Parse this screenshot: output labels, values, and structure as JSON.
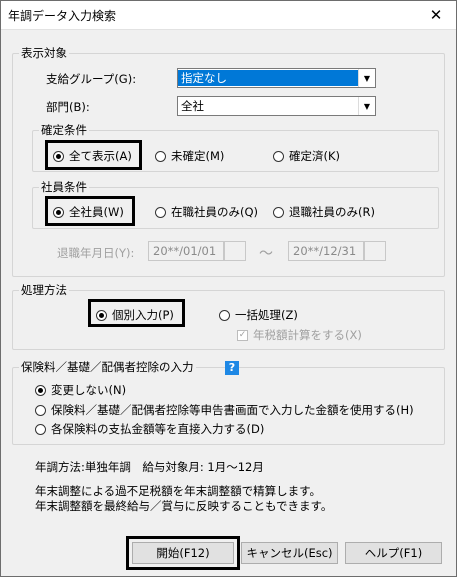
{
  "window": {
    "title": "年調データ入力検索",
    "close_glyph": "✕"
  },
  "display_target": {
    "label": "表示対象",
    "group_label": "支給グループ(G):",
    "group_value": "指定なし",
    "dept_label": "部門(B):",
    "dept_value": "全社",
    "confirm": {
      "label": "確定条件",
      "options": [
        "全て表示(A)",
        "未確定(M)",
        "確定済(K)"
      ],
      "selected": 0
    },
    "employee": {
      "label": "社員条件",
      "options": [
        "全社員(W)",
        "在職社員のみ(Q)",
        "退職社員のみ(R)"
      ],
      "selected": 0
    },
    "retire_label": "退職年月日(Y):",
    "retire_from": "20**/01/01",
    "retire_tilde": "～",
    "retire_to": "20**/12/31"
  },
  "process": {
    "label": "処理方法",
    "individual": "個別入力(P)",
    "bulk": "一括処理(Z)",
    "calc_check": "年税額計算をする(X)",
    "selected": "individual"
  },
  "insurance": {
    "label": "保険料／基礎／配偶者控除の入力",
    "help": "?",
    "options": [
      "変更しない(N)",
      "保険料／基礎／配偶者控除等申告書画面で入力した金額を使用する(H)",
      "各保険料の支払金額等を直接入力する(D)"
    ],
    "selected": 0
  },
  "info": {
    "method": "年調方法:単独年調　給与対象月: 1月～12月",
    "line1": "年末調整による過不足税額を年末調整額で精算します。",
    "line2": "年末調整額を最終給与／賞与に反映することもできます。"
  },
  "buttons": {
    "start": "開始(F12)",
    "cancel": "キャンセル(Esc)",
    "help": "ヘルプ(F1)"
  },
  "colors": {
    "selection": "#0078d7",
    "help_icon": "#1e88e5",
    "highlight_border": "#000000"
  }
}
